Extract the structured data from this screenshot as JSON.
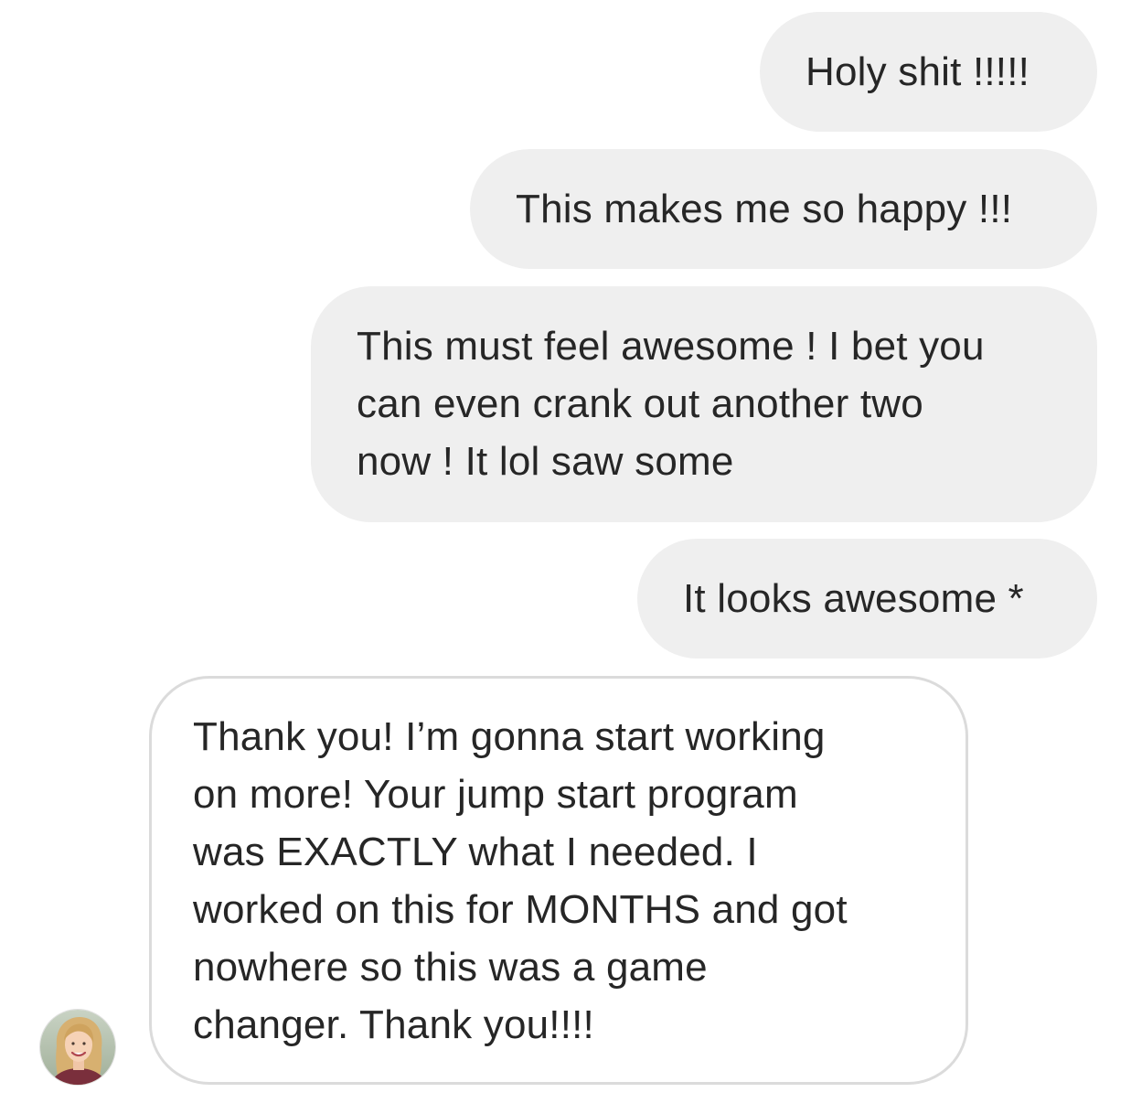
{
  "thread": {
    "messages": [
      {
        "from": "me",
        "text": "Holy shit !!!!!"
      },
      {
        "from": "me",
        "text": "This makes me so happy !!!"
      },
      {
        "from": "me",
        "text": "This must feel awesome ! I bet you\ncan even crank out another two\nnow ! It lol saw some"
      },
      {
        "from": "me",
        "text": "It looks awesome *"
      },
      {
        "from": "them",
        "text": "Thank you! I’m gonna start working\non more! Your jump start program\nwas EXACTLY what I needed. I\nworked on this for MONTHS and got\nnowhere so this was a game\nchanger. Thank you!!!!"
      }
    ]
  },
  "icons": {
    "contact_avatar": "profile-photo-avatar"
  },
  "colors": {
    "outgoing_bubble": "#efefef",
    "incoming_border": "#dbdbdb",
    "text": "#262626"
  }
}
